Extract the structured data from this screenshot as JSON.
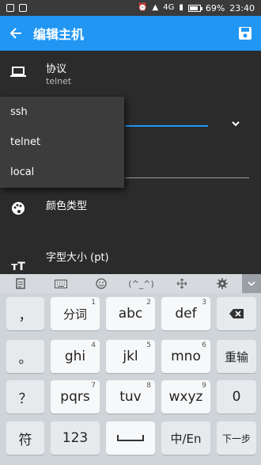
{
  "status_bar": {
    "battery": "69%",
    "time": "23:40",
    "network": "4G"
  },
  "toolbar": {
    "title": "编辑主机"
  },
  "protocol": {
    "label": "协议",
    "value": "telnet"
  },
  "dropdown": {
    "options": [
      "ssh",
      "telnet",
      "local"
    ]
  },
  "color_type": {
    "label": "颜色类型"
  },
  "font_size": {
    "label": "字型大小 (pt)"
  },
  "kb_toolbar": {
    "emoticon": "(^_^)"
  },
  "keyboard": {
    "row1": [
      {
        "label": "，",
        "num": ""
      },
      {
        "label": "分词",
        "num": "1"
      },
      {
        "label": "abc",
        "num": "2"
      },
      {
        "label": "def",
        "num": "3"
      }
    ],
    "row2": [
      {
        "label": "。",
        "num": ""
      },
      {
        "label": "ghi",
        "num": "4"
      },
      {
        "label": "jkl",
        "num": "5"
      },
      {
        "label": "mno",
        "num": "6"
      },
      {
        "label": "重输",
        "num": ""
      }
    ],
    "row3": [
      {
        "label": "？",
        "num": ""
      },
      {
        "label": "pqrs",
        "num": "7"
      },
      {
        "label": "tuv",
        "num": "8"
      },
      {
        "label": "wxyz",
        "num": "9"
      },
      {
        "label": "0",
        "num": ""
      }
    ],
    "row4": [
      {
        "label": "符",
        "num": ""
      },
      {
        "label": "123",
        "num": ""
      },
      {
        "label": "中/En",
        "num": ""
      },
      {
        "label": "下一步",
        "num": ""
      }
    ]
  }
}
